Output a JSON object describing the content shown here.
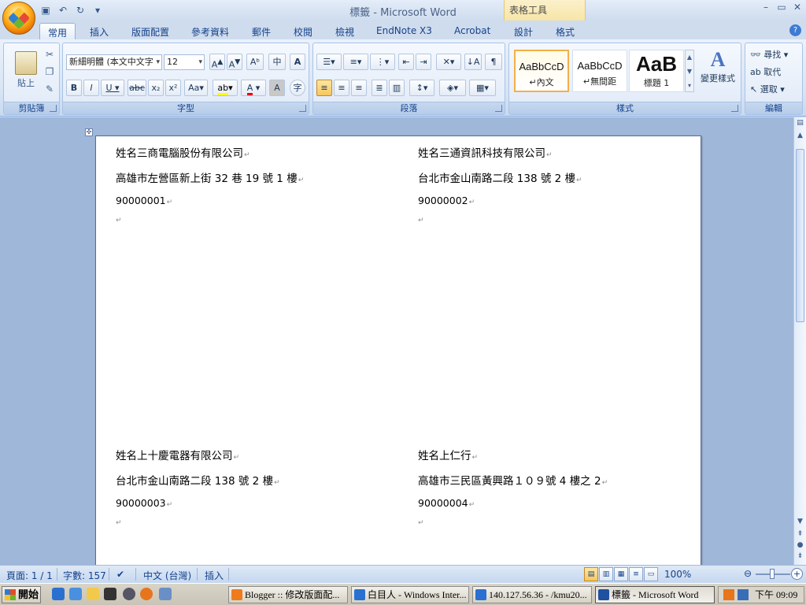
{
  "window": {
    "title": "標籤 - Microsoft Word",
    "contextual_header": "表格工具"
  },
  "tabs": [
    {
      "label": "常用",
      "active": true
    },
    {
      "label": "插入"
    },
    {
      "label": "版面配置"
    },
    {
      "label": "參考資料"
    },
    {
      "label": "郵件"
    },
    {
      "label": "校閱"
    },
    {
      "label": "檢視"
    },
    {
      "label": "EndNote X3"
    },
    {
      "label": "Acrobat"
    },
    {
      "label": "設計"
    },
    {
      "label": "格式"
    }
  ],
  "ribbon": {
    "clipboard": {
      "label": "剪貼簿",
      "paste": "貼上"
    },
    "font": {
      "label": "字型",
      "font_name": "新細明體 (本文中文字",
      "font_size": "12"
    },
    "paragraph": {
      "label": "段落"
    },
    "styles": {
      "label": "樣式",
      "items": [
        {
          "sample": "AaBbCcD",
          "name": "↵內文"
        },
        {
          "sample": "AaBbCcD",
          "name": "↵無間距"
        },
        {
          "sample": "AaB",
          "name": "標題 1"
        }
      ],
      "change_styles": "變更樣式"
    },
    "editing": {
      "label": "編輯",
      "find": "尋找",
      "replace": "取代",
      "select": "選取"
    }
  },
  "document": {
    "labels": [
      {
        "name": "姓名三商電腦股份有限公司",
        "address": "高雄市左營區新上街 32 巷 19 號 1 樓",
        "code": "90000001"
      },
      {
        "name": "姓名三通資訊科技有限公司",
        "address": "台北市金山南路二段 138 號 2 樓",
        "code": "90000002"
      },
      {
        "name": "姓名上十慶電器有限公司",
        "address": "台北市金山南路二段 138 號 2 樓",
        "code": "90000003"
      },
      {
        "name": "姓名上仁行",
        "address": "高雄市三民區黃興路１０９號 4 樓之 2",
        "code": "90000004"
      }
    ]
  },
  "status": {
    "page": "頁面: 1 / 1",
    "words": "字數: 157",
    "language": "中文 (台灣)",
    "mode": "插入",
    "zoom": "100%"
  },
  "taskbar": {
    "start": "開始",
    "buttons": [
      {
        "label": "Blogger :: 修改版面配...",
        "color": "#f07b1c"
      },
      {
        "label": "白目人 - Windows Inter...",
        "color": "#2a70d0"
      },
      {
        "label": "140.127.56.36 - /kmu20...",
        "color": "#2a70d0"
      },
      {
        "label": "標籤 - Microsoft Word",
        "color": "#2050a0",
        "active": true
      }
    ],
    "clock": "下午 09:09"
  }
}
